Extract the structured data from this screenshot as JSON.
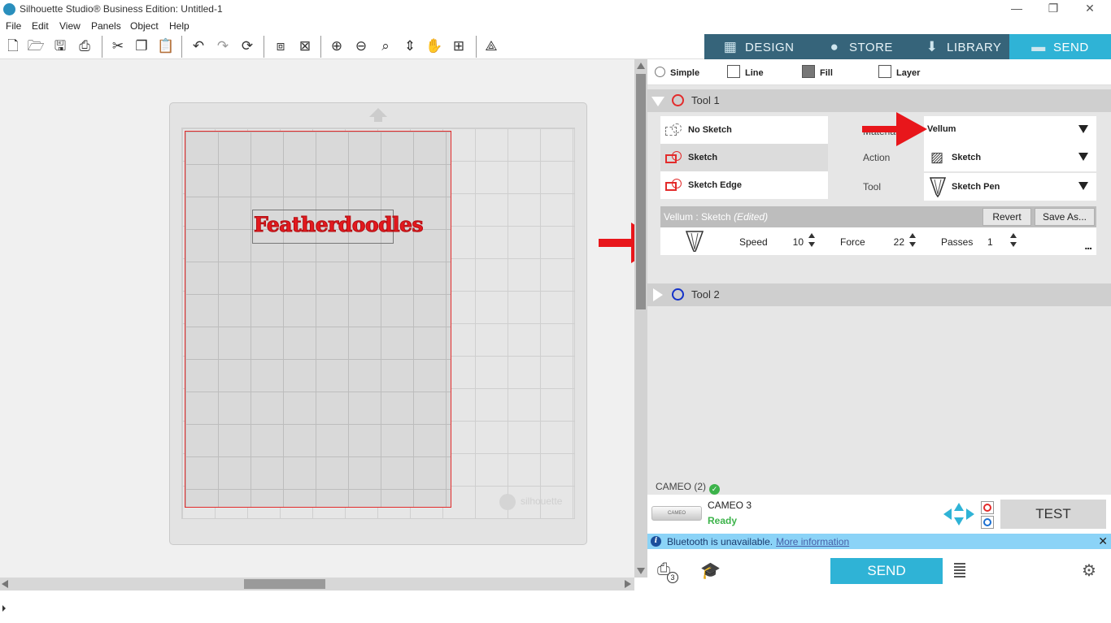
{
  "window": {
    "title": "Silhouette Studio® Business Edition: Untitled-1",
    "minimize": "—",
    "restore": "❐",
    "close": "✕"
  },
  "menu": [
    "File",
    "Edit",
    "View",
    "Panels",
    "Object",
    "Help"
  ],
  "nav_tabs": [
    {
      "label": "DESIGN",
      "icon": "grid-icon"
    },
    {
      "label": "STORE",
      "icon": "silhouette-s-icon"
    },
    {
      "label": "LIBRARY",
      "icon": "download-icon"
    },
    {
      "label": "SEND",
      "icon": "cutter-icon",
      "active": true
    }
  ],
  "canvas": {
    "design_text": "Featherdoodles",
    "brand_watermark": "silhouette"
  },
  "send_panel": {
    "mode_tabs": [
      "Simple",
      "Line",
      "Fill",
      "Layer"
    ],
    "tool1_label": "Tool 1",
    "tool2_label": "Tool 2",
    "sketch_options": [
      "No Sketch",
      "Sketch",
      "Sketch Edge"
    ],
    "selected_sketch": "Sketch",
    "material_label": "Material",
    "material_value": "Vellum",
    "action_label": "Action",
    "action_value": "Sketch",
    "tool_label": "Tool",
    "tool_value": "Sketch Pen",
    "preset_name": "Vellum : Sketch",
    "preset_edited": "(Edited)",
    "revert_label": "Revert",
    "save_as_label": "Save As...",
    "speed_label": "Speed",
    "speed_value": "10",
    "force_label": "Force",
    "force_value": "22",
    "passes_label": "Passes",
    "passes_value": "1",
    "more_label": "..."
  },
  "device": {
    "header": "CAMEO (2)",
    "name": "CAMEO 3",
    "status": "Ready",
    "thumb_label": "CAMEO",
    "test_label": "TEST",
    "send_label": "SEND",
    "queue_count": "3"
  },
  "bluetooth": {
    "message": "Bluetooth is unavailable.",
    "link": "More information",
    "close": "✕"
  },
  "colors": {
    "accent": "#2fb3d6",
    "nav_bg": "#36647a",
    "tool1": "#e32b2b",
    "tool2": "#1432c9",
    "ready": "#3cb34a",
    "annotation_arrow": "#e8161b"
  }
}
